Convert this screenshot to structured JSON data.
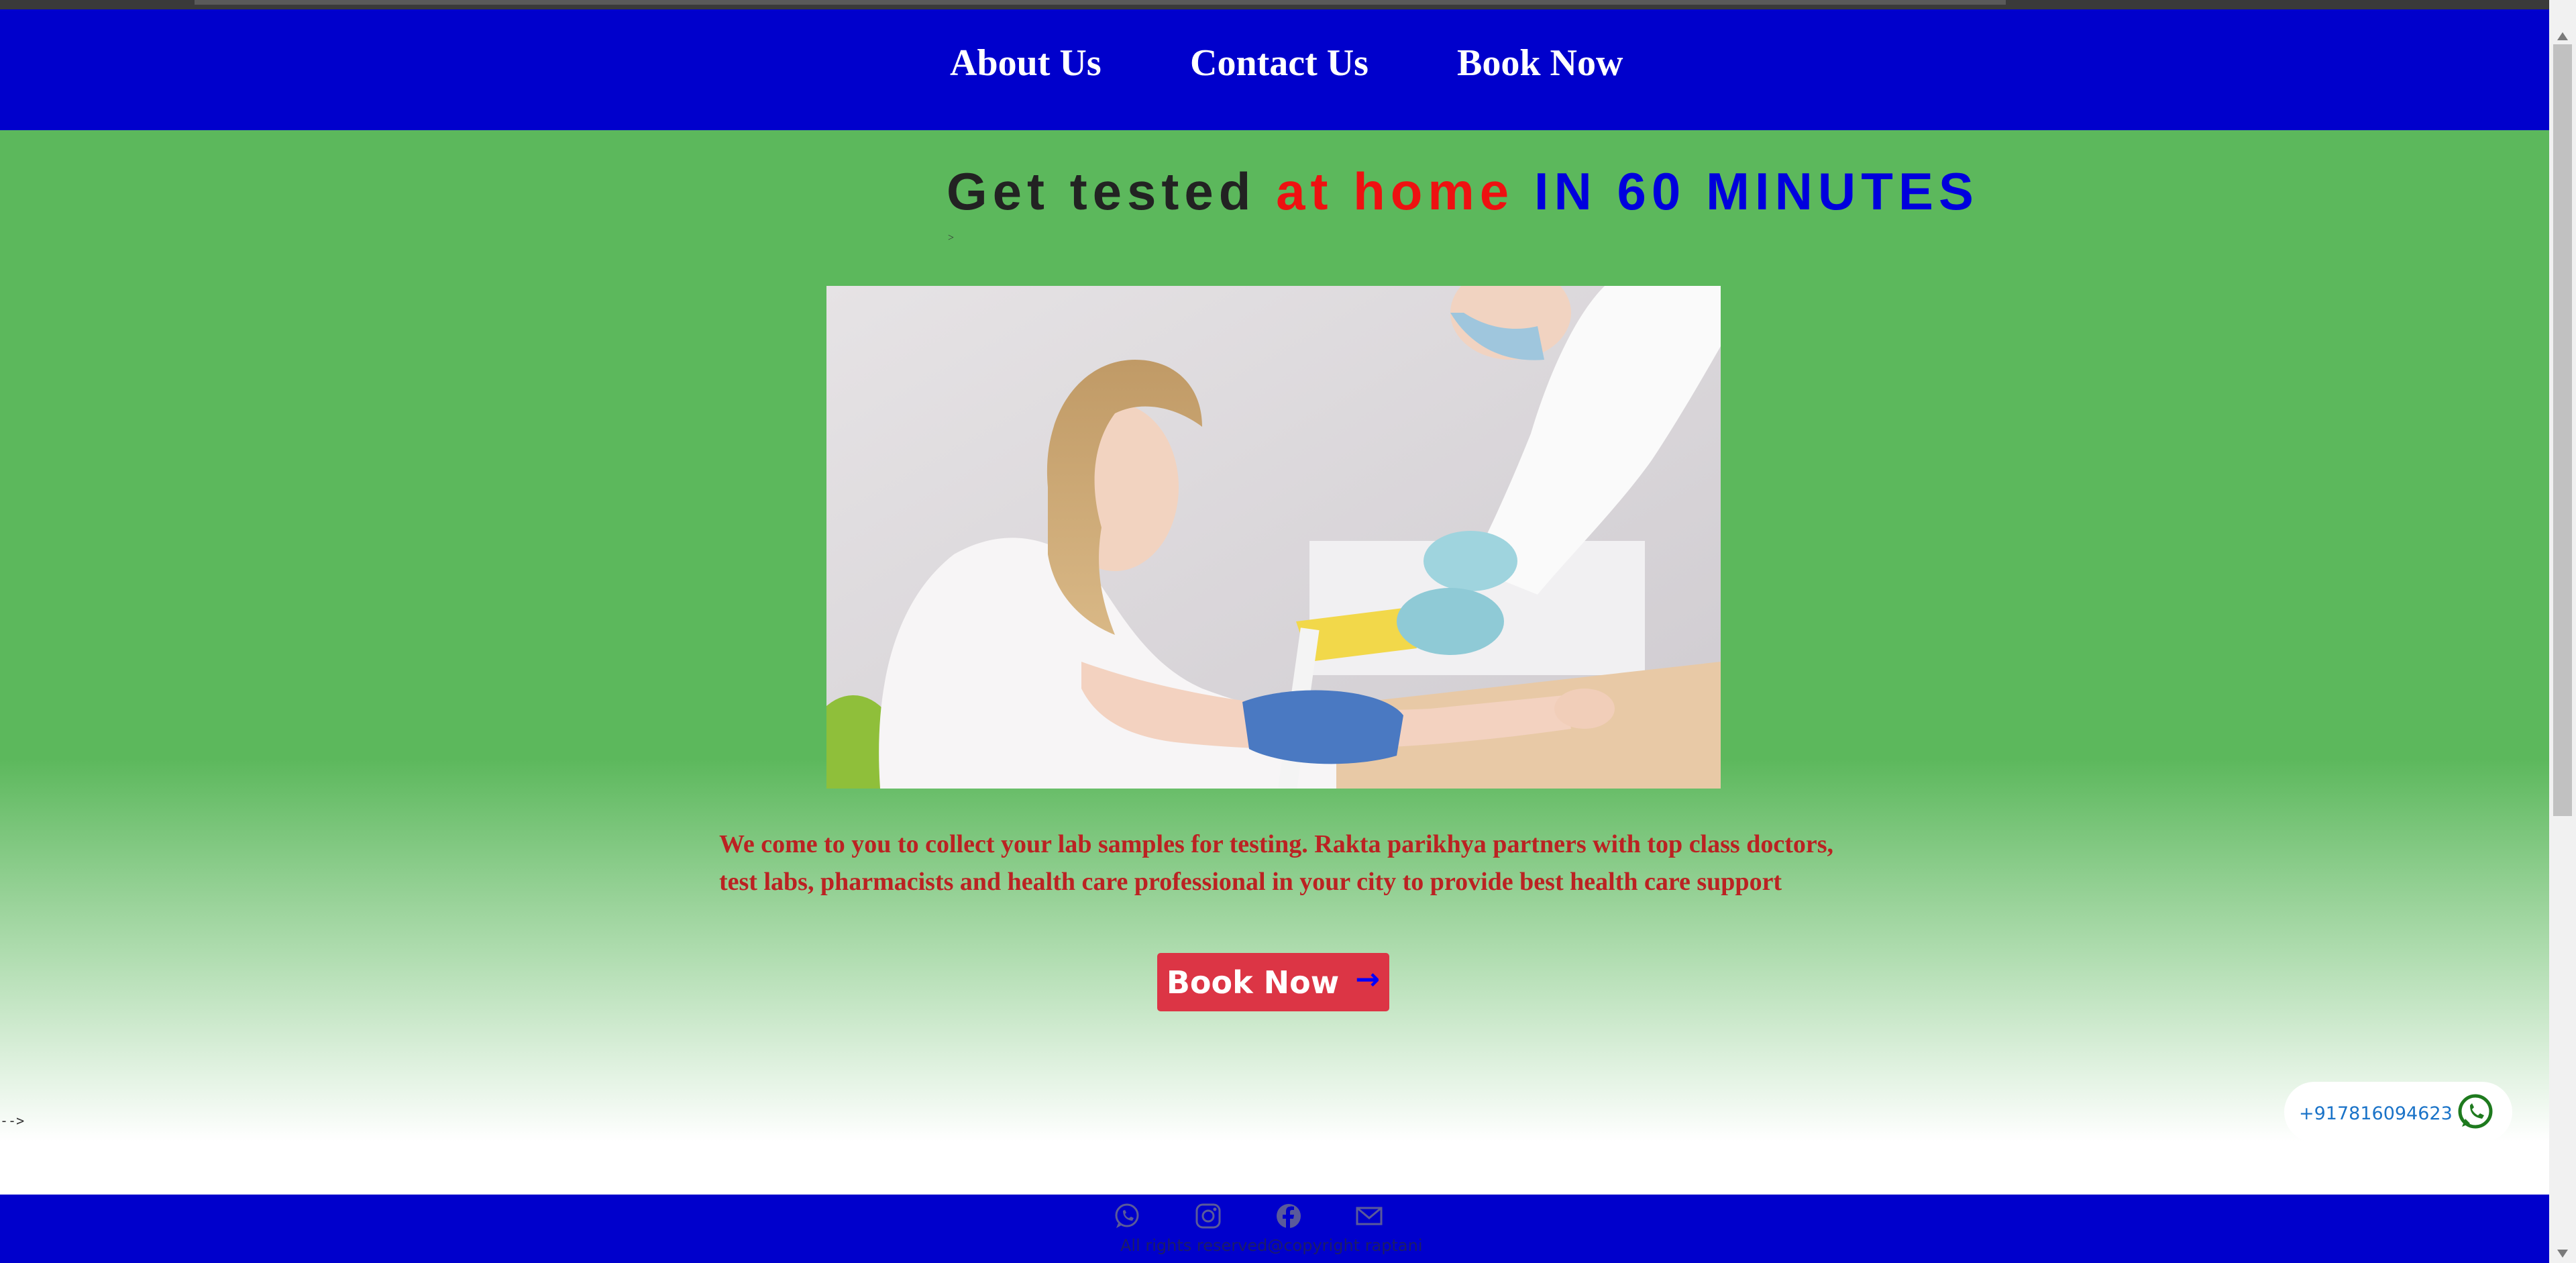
{
  "nav": {
    "about": "About Us",
    "contact": "Contact Us",
    "book": "Book Now"
  },
  "hero": {
    "headline_part1": "Get tested",
    "headline_part2": "at home",
    "headline_part3": "IN 60 MINUTES",
    "small_mark": ">",
    "description": "We come to you to collect your lab samples for testing. Rakta parikhya partners with top class doctors, test labs, pharmacists and health care professional in your city to provide best health care support",
    "button_label": "Book Now",
    "button_arrow": "→"
  },
  "stray_comment": "-->",
  "whatsapp": {
    "phone": "+917816094623",
    "icon": "whatsapp-icon"
  },
  "footer": {
    "icons": [
      "whatsapp-icon",
      "instagram-icon",
      "facebook-icon",
      "mail-icon"
    ],
    "copyright": "All rights reserved@copyright raptani"
  },
  "colors": {
    "nav_bg": "#0000cc",
    "hero_green": "#5cb85c",
    "accent_red": "#ee1111",
    "accent_blue": "#0000dd",
    "button_red": "#dc3545",
    "description_red": "#bb2222"
  }
}
